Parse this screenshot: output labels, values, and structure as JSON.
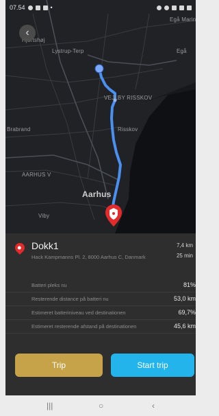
{
  "status_bar": {
    "time": "07.54"
  },
  "map": {
    "labels": {
      "top_right": "Egå Marina",
      "hjortshoj": "Hjortshøj",
      "lystrup": "Lystrup-Terp",
      "ega": "Egå",
      "vejlby": "VEJLBY RISSKOV",
      "risskov": "Risskov",
      "brabrand": "Brabrand",
      "aarhus_v": "AARHUS V",
      "aarhus": "Aarhus",
      "viby": "Viby"
    },
    "route_color": "#4a90f0",
    "destination_color": "#e22b2b"
  },
  "destination": {
    "title": "Dokk1",
    "address": "Hack Kampmanns Pl. 2, 8000 Aarhus C, Danmark",
    "distance": "7,4 km",
    "time": "25 min"
  },
  "stats": [
    {
      "label": "Batteri pleks nu",
      "value": "81%"
    },
    {
      "label": "Resterende distance på batteri nu",
      "value": "53,0 km"
    },
    {
      "label": "Estimeret batteriniveau ved destinationen",
      "value": "69,7%"
    },
    {
      "label": "Estimeret resterende afstand på destinationen",
      "value": "45,6 km"
    }
  ],
  "buttons": {
    "trip": "Trip",
    "start": "Start trip"
  },
  "colors": {
    "trip_button": "#c6a249",
    "start_button": "#22b4ea"
  }
}
